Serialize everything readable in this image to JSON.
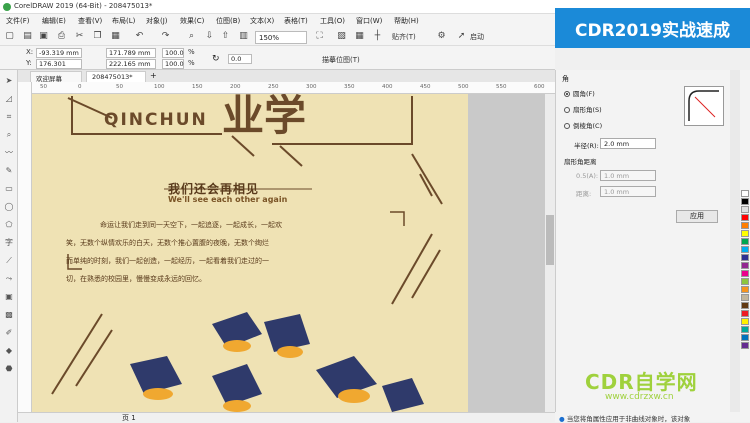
{
  "window": {
    "title": "CorelDRAW 2019 (64-Bit) - 208475013*"
  },
  "brand_banner": "CDR2019实战速成",
  "menu": [
    "文件(F)",
    "编辑(E)",
    "查看(V)",
    "布局(L)",
    "对象(J)",
    "效果(C)",
    "位图(B)",
    "文本(X)",
    "表格(T)",
    "工具(O)",
    "窗口(W)",
    "帮助(H)"
  ],
  "toolbar": {
    "zoom": "150%",
    "snap_label": "贴齐(T)",
    "launch_label": "启动"
  },
  "props": {
    "x": "-93.319 mm",
    "y": "176.301 mm",
    "w": "171.789 mm",
    "h": "222.165 mm",
    "sx": "100.0",
    "sy": "100.0",
    "pct": "%",
    "angle": "0.0",
    "wrap_label": "描摹位图(T)"
  },
  "tabs": {
    "welcome": "欢迎屏幕",
    "doc": "208475013*",
    "add": "+"
  },
  "ruler_labels": [
    "50",
    "0",
    "50",
    "100",
    "150",
    "200",
    "250",
    "300",
    "350",
    "400",
    "450",
    "500",
    "550",
    "600"
  ],
  "poster": {
    "big_text": "业学",
    "qinchun": "QINCHUN",
    "heading": "我们还会再相见",
    "subtitle": "We'll see each other again",
    "lines": [
      "命运让我们走到同一天空下，一起追逐，一起成长，一起欢",
      "笑，无数个纵情欢乐的白天，无数个推心置腹的夜晚，无数个绚烂",
      "而单纯的时刻，我们一起创造，一起经历，一起看着我们走过的一",
      "切，在熟悉的校园里，慢慢变成永远的回忆。"
    ]
  },
  "page_tab": "页 1",
  "docker": {
    "title": "角",
    "opt_round": "圆角(F)",
    "opt_scallop": "扇形角(S)",
    "opt_chamfer": "倒棱角(C)",
    "radius_label": "半径(R):",
    "radius_value": "2.0 mm",
    "distance_label": "扇形角距离",
    "dist_a_label": "0.5(A):",
    "dist_a_value": "1.0 mm",
    "dist_b_label": "距离:",
    "dist_b_value": "1.0 mm",
    "apply": "应用"
  },
  "status": "当您将角属性应用于非曲线对象时，该对象",
  "watermark": {
    "main": "CDR自学网",
    "url": "www.cdrzxw.cn"
  },
  "palette_colors": [
    "#ffffff",
    "#000000",
    "#e0e0e0",
    "#ff0000",
    "#ff7f00",
    "#ffff00",
    "#00a651",
    "#00aeef",
    "#2e3192",
    "#92278f",
    "#ec008c",
    "#8dc63f",
    "#f7941d",
    "#c2b59b",
    "#603913",
    "#ed1c24",
    "#fff200",
    "#00a99d",
    "#0072bc",
    "#662d91"
  ]
}
